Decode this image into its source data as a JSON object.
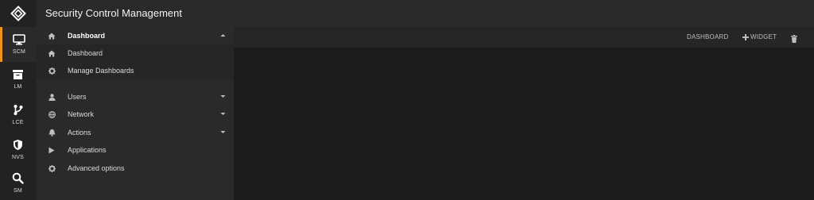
{
  "app": {
    "title": "Security Control Management"
  },
  "rail": {
    "items": [
      {
        "label": "SCM",
        "icon": "monitor-icon",
        "active": true
      },
      {
        "label": "LM",
        "icon": "archive-icon"
      },
      {
        "label": "LCE",
        "icon": "branch-icon"
      },
      {
        "label": "NVS",
        "icon": "shield-icon"
      },
      {
        "label": "SM",
        "icon": "search-icon"
      }
    ]
  },
  "nav": {
    "section": {
      "label": "Dashboard",
      "expanded": true
    },
    "subitems": [
      {
        "label": "Dashboard",
        "icon": "home-icon"
      },
      {
        "label": "Manage Dashboards",
        "icon": "gear-icon"
      }
    ],
    "items": [
      {
        "label": "Users",
        "icon": "user-icon",
        "has_caret": true
      },
      {
        "label": "Network",
        "icon": "globe-icon",
        "has_caret": true
      },
      {
        "label": "Actions",
        "icon": "bell-icon",
        "has_caret": true
      },
      {
        "label": "Applications",
        "icon": "play-icon",
        "has_caret": false
      },
      {
        "label": "Advanced options",
        "icon": "gear-icon",
        "has_caret": false
      }
    ]
  },
  "toolbar": {
    "dashboard_label": "DASHBOARD",
    "widget_label": "WIDGET",
    "delete_icon": "trash-icon"
  },
  "colors": {
    "accent": "#f0941f"
  }
}
